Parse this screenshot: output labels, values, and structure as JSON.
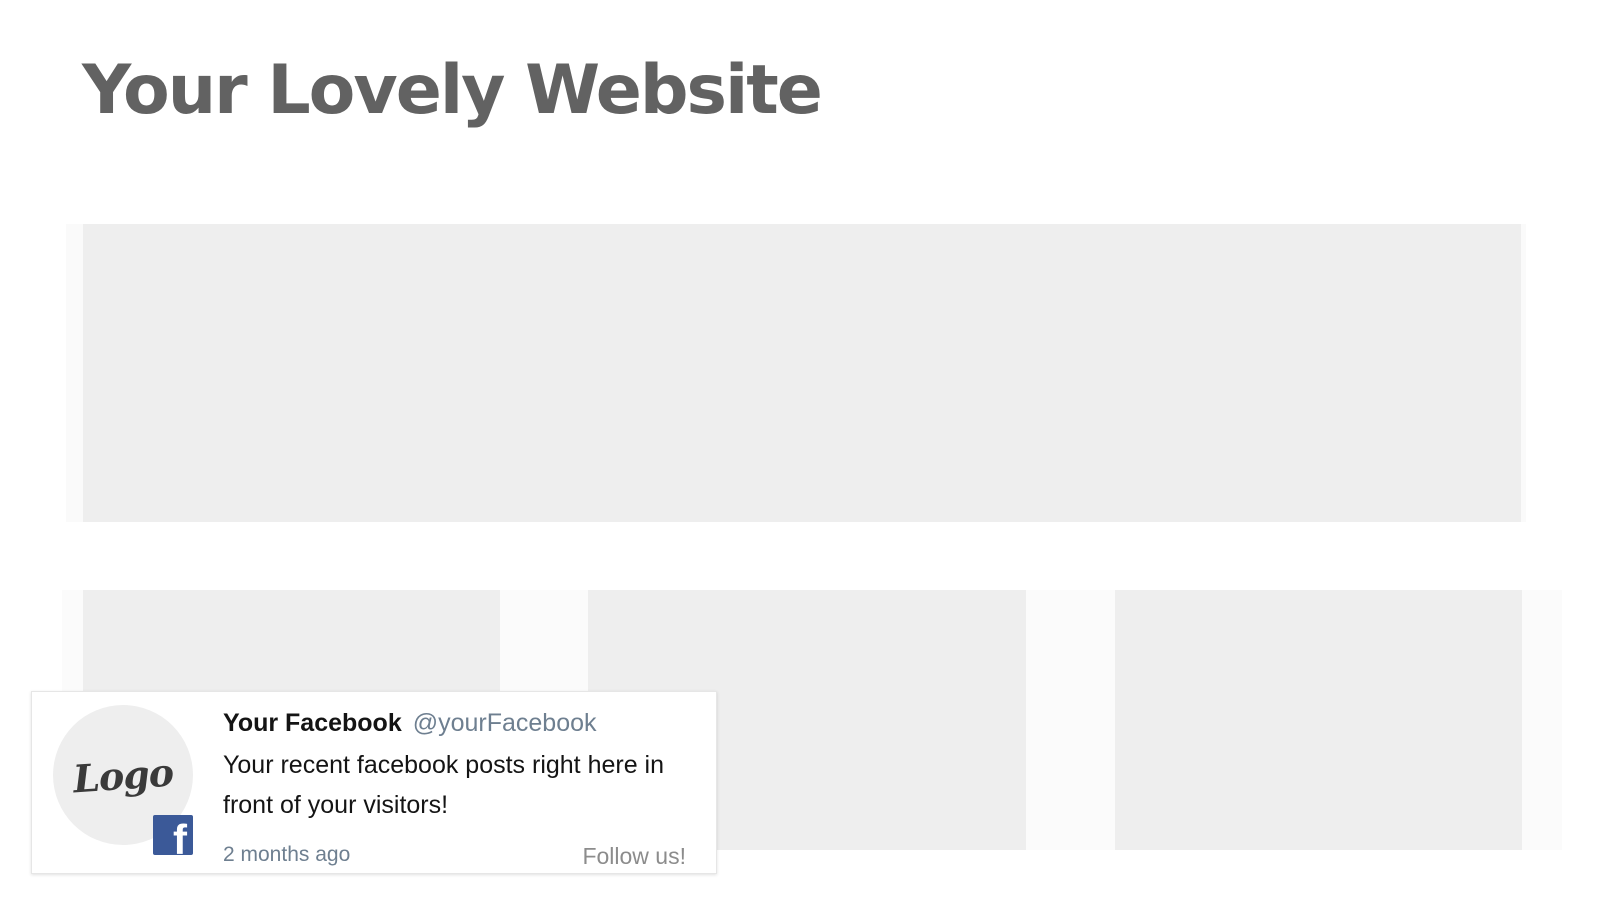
{
  "site": {
    "title": "Your Lovely Website"
  },
  "facebook_widget": {
    "logo_text": "Logo",
    "badge_icon": "facebook-icon",
    "name": "Your Facebook",
    "handle": "@yourFacebook",
    "message": "Your recent facebook posts right here in front of your visitors!",
    "timestamp": "2 months ago",
    "follow_label": "Follow us!"
  },
  "colors": {
    "title": "#626262",
    "placeholder": "#eeeeee",
    "facebook_blue": "#3b5998",
    "handle": "#6e7f90",
    "follow": "#8c8c8c"
  }
}
